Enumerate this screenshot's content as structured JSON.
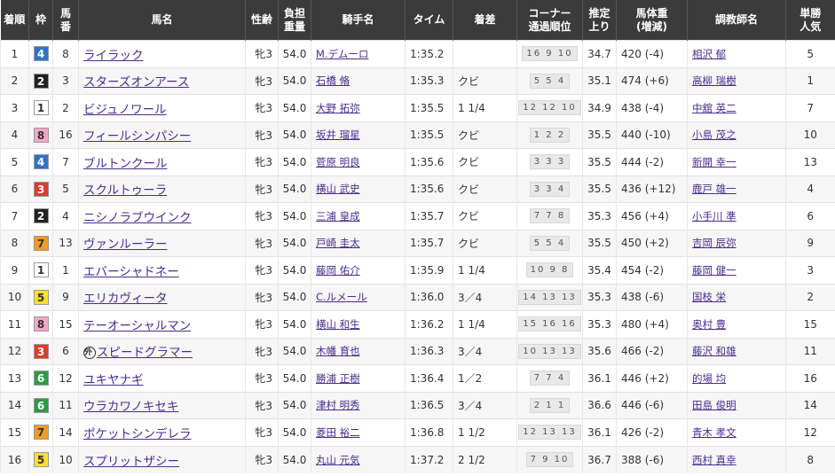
{
  "headers": {
    "rank": [
      "着順"
    ],
    "waku": [
      "枠"
    ],
    "num": [
      "馬",
      "番"
    ],
    "horse": [
      "馬名"
    ],
    "sexage": [
      "性齢"
    ],
    "weight": [
      "負担",
      "重量"
    ],
    "jockey": [
      "騎手名"
    ],
    "time": [
      "タイム"
    ],
    "margin": [
      "着差"
    ],
    "corner": [
      "コーナー",
      "通過順位"
    ],
    "last3f": [
      "推定",
      "上り"
    ],
    "bodyweight": [
      "馬体重",
      "(増減)"
    ],
    "trainer": [
      "調教師名"
    ],
    "odds": [
      "単勝",
      "人気"
    ]
  },
  "waku_colors": {
    "1": {
      "bg": "#ffffff",
      "fg": "#333333"
    },
    "2": {
      "bg": "#222222",
      "fg": "#ffffff"
    },
    "3": {
      "bg": "#e03a2e",
      "fg": "#ffffff"
    },
    "4": {
      "bg": "#2e73c9",
      "fg": "#ffffff"
    },
    "5": {
      "bg": "#f7e12a",
      "fg": "#333333"
    },
    "6": {
      "bg": "#2e9a45",
      "fg": "#ffffff"
    },
    "7": {
      "bg": "#f19b24",
      "fg": "#333333"
    },
    "8": {
      "bg": "#f3a8c6",
      "fg": "#333333"
    }
  },
  "rows": [
    {
      "rank": "1",
      "waku": "4",
      "num": "8",
      "horse": "ライラック",
      "gai": "",
      "sexage": "牝3",
      "weight": "54.0",
      "jockey": "M.デムーロ",
      "time": "1:35.2",
      "margin": "",
      "corner": "16 9 10",
      "last3f": "34.7",
      "bodyweight": "420 (-4)",
      "trainer": "相沢 郁",
      "pop": "5"
    },
    {
      "rank": "2",
      "waku": "2",
      "num": "3",
      "horse": "スターズオンアース",
      "gai": "",
      "sexage": "牝3",
      "weight": "54.0",
      "jockey": "石橋 脩",
      "time": "1:35.3",
      "margin": "クビ",
      "corner": "5 5 4",
      "last3f": "35.1",
      "bodyweight": "474 (+6)",
      "trainer": "高柳 瑞樹",
      "pop": "1"
    },
    {
      "rank": "3",
      "waku": "1",
      "num": "2",
      "horse": "ビジュノワール",
      "gai": "",
      "sexage": "牝3",
      "weight": "54.0",
      "jockey": "大野 拓弥",
      "time": "1:35.5",
      "margin": "1 1/4",
      "corner": "12 12 10",
      "last3f": "34.9",
      "bodyweight": "438 (-4)",
      "trainer": "中舘 英二",
      "pop": "7"
    },
    {
      "rank": "4",
      "waku": "8",
      "num": "16",
      "horse": "フィールシンパシー",
      "gai": "",
      "sexage": "牝3",
      "weight": "54.0",
      "jockey": "坂井 瑠星",
      "time": "1:35.5",
      "margin": "クビ",
      "corner": "1 2 2",
      "last3f": "35.5",
      "bodyweight": "440 (-10)",
      "trainer": "小島 茂之",
      "pop": "10"
    },
    {
      "rank": "5",
      "waku": "4",
      "num": "7",
      "horse": "ブルトンクール",
      "gai": "",
      "sexage": "牝3",
      "weight": "54.0",
      "jockey": "菅原 明良",
      "time": "1:35.6",
      "margin": "クビ",
      "corner": "3 3 3",
      "last3f": "35.5",
      "bodyweight": "444 (-2)",
      "trainer": "新開 幸一",
      "pop": "13"
    },
    {
      "rank": "6",
      "waku": "3",
      "num": "5",
      "horse": "スクルトゥーラ",
      "gai": "",
      "sexage": "牝3",
      "weight": "54.0",
      "jockey": "横山 武史",
      "time": "1:35.6",
      "margin": "クビ",
      "corner": "3 3 4",
      "last3f": "35.5",
      "bodyweight": "436 (+12)",
      "trainer": "鹿戸 雄一",
      "pop": "4"
    },
    {
      "rank": "7",
      "waku": "2",
      "num": "4",
      "horse": "ニシノラブウインク",
      "gai": "",
      "sexage": "牝3",
      "weight": "54.0",
      "jockey": "三浦 皇成",
      "time": "1:35.7",
      "margin": "クビ",
      "corner": "7 7 8",
      "last3f": "35.3",
      "bodyweight": "456 (+4)",
      "trainer": "小手川 準",
      "pop": "6"
    },
    {
      "rank": "8",
      "waku": "7",
      "num": "13",
      "horse": "ヴァンルーラー",
      "gai": "",
      "sexage": "牝3",
      "weight": "54.0",
      "jockey": "戸崎 圭太",
      "time": "1:35.7",
      "margin": "クビ",
      "corner": "5 5 4",
      "last3f": "35.5",
      "bodyweight": "450 (+2)",
      "trainer": "吉岡 辰弥",
      "pop": "9"
    },
    {
      "rank": "9",
      "waku": "1",
      "num": "1",
      "horse": "エバーシャドネー",
      "gai": "",
      "sexage": "牝3",
      "weight": "54.0",
      "jockey": "藤岡 佑介",
      "time": "1:35.9",
      "margin": "1 1/4",
      "corner": "10 9 8",
      "last3f": "35.4",
      "bodyweight": "454 (-2)",
      "trainer": "藤岡 健一",
      "pop": "3"
    },
    {
      "rank": "10",
      "waku": "5",
      "num": "9",
      "horse": "エリカヴィータ",
      "gai": "",
      "sexage": "牝3",
      "weight": "54.0",
      "jockey": "C.ルメール",
      "time": "1:36.0",
      "margin": "3／4",
      "corner": "14 13 13",
      "last3f": "35.3",
      "bodyweight": "438 (-6)",
      "trainer": "国枝 栄",
      "pop": "2"
    },
    {
      "rank": "11",
      "waku": "8",
      "num": "15",
      "horse": "テーオーシャルマン",
      "gai": "",
      "sexage": "牝3",
      "weight": "54.0",
      "jockey": "横山 和生",
      "time": "1:36.2",
      "margin": "1 1/4",
      "corner": "15 16 16",
      "last3f": "35.3",
      "bodyweight": "480 (+4)",
      "trainer": "奥村 豊",
      "pop": "15"
    },
    {
      "rank": "12",
      "waku": "3",
      "num": "6",
      "horse": "スピードグラマー",
      "gai": "外",
      "sexage": "牝3",
      "weight": "54.0",
      "jockey": "木幡 育也",
      "time": "1:36.3",
      "margin": "3／4",
      "corner": "10 13 13",
      "last3f": "35.6",
      "bodyweight": "466 (-2)",
      "trainer": "藤沢 和雄",
      "pop": "11"
    },
    {
      "rank": "13",
      "waku": "6",
      "num": "12",
      "horse": "ユキヤナギ",
      "gai": "",
      "sexage": "牝3",
      "weight": "54.0",
      "jockey": "勝浦 正樹",
      "time": "1:36.4",
      "margin": "1／2",
      "corner": "7 7 4",
      "last3f": "36.1",
      "bodyweight": "446 (+2)",
      "trainer": "的場 均",
      "pop": "16"
    },
    {
      "rank": "14",
      "waku": "6",
      "num": "11",
      "horse": "ウラカワノキセキ",
      "gai": "",
      "sexage": "牝3",
      "weight": "54.0",
      "jockey": "津村 明秀",
      "time": "1:36.5",
      "margin": "3／4",
      "corner": "2 1 1",
      "last3f": "36.6",
      "bodyweight": "446 (-6)",
      "trainer": "田島 俊明",
      "pop": "14"
    },
    {
      "rank": "15",
      "waku": "7",
      "num": "14",
      "horse": "ポケットシンデレラ",
      "gai": "",
      "sexage": "牝3",
      "weight": "54.0",
      "jockey": "菱田 裕二",
      "time": "1:36.8",
      "margin": "1 1/2",
      "corner": "12 13 13",
      "last3f": "36.1",
      "bodyweight": "426 (-2)",
      "trainer": "青木 孝文",
      "pop": "12"
    },
    {
      "rank": "16",
      "waku": "5",
      "num": "10",
      "horse": "スプリットザシー",
      "gai": "",
      "sexage": "牝3",
      "weight": "54.0",
      "jockey": "丸山 元気",
      "time": "1:37.2",
      "margin": "2 1/2",
      "corner": "7 9 10",
      "last3f": "36.7",
      "bodyweight": "388 (-6)",
      "trainer": "西村 真幸",
      "pop": "8"
    }
  ]
}
